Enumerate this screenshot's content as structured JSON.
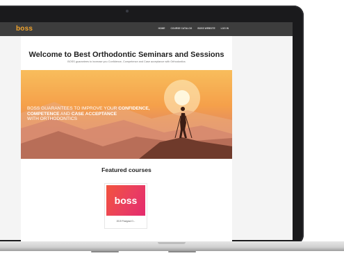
{
  "site": {
    "logo": "boss",
    "nav_items": [
      "HOME",
      "COURSE CATALOG",
      "BOSS WEBSITE",
      "LOG IN"
    ]
  },
  "page": {
    "title": "Welcome to Best Orthodontic Seminars and Sessions",
    "subtitle": "BOSS guarantees to increase you Confidence, Competence and Case acceptance with Orthodontics"
  },
  "hero": {
    "line1_normal": "BOSS GUARANTEES TO IMPROVE YOUR ",
    "line1_bold": "CONFIDENCE,",
    "line2_bold1": "COMPETENCE",
    "line2_normal": " AND ",
    "line2_bold2": "CASE ACCEPTANCE",
    "line3": "WITH ORTHODONTICS"
  },
  "featured": {
    "heading": "Featured courses",
    "course": {
      "thumb_label": "boss",
      "title": "2019 Postgrad O..."
    }
  },
  "colors": {
    "logo": "#f2a42c",
    "navbar": "#3d3d3d",
    "thumb_start": "#f2533d",
    "thumb_end": "#e42a6d"
  }
}
